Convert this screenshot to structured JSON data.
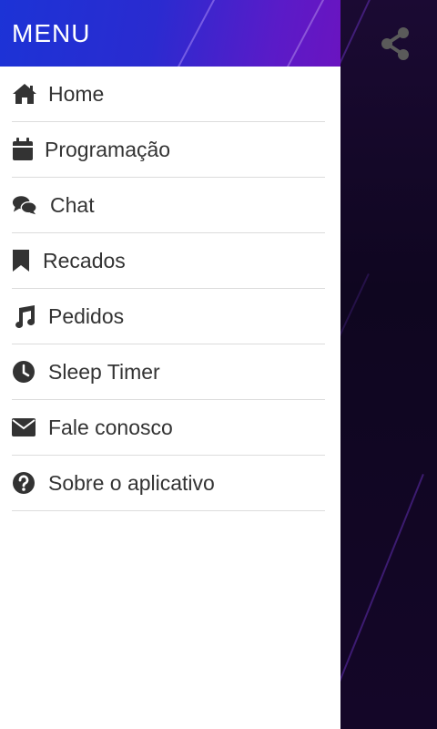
{
  "drawer": {
    "title": "MENU",
    "items": [
      {
        "label": "Home",
        "icon": "home-icon"
      },
      {
        "label": "Programação",
        "icon": "calendar-icon"
      },
      {
        "label": "Chat",
        "icon": "chat-icon"
      },
      {
        "label": "Recados",
        "icon": "bookmark-icon"
      },
      {
        "label": "Pedidos",
        "icon": "music-icon"
      },
      {
        "label": "Sleep Timer",
        "icon": "clock-icon"
      },
      {
        "label": "Fale conosco",
        "icon": "envelope-icon"
      },
      {
        "label": "Sobre o aplicativo",
        "icon": "question-icon"
      }
    ]
  },
  "share": {
    "icon": "share-icon"
  },
  "colors": {
    "header_start": "#1c33d6",
    "header_end": "#6a14c0",
    "background": "#140628",
    "text": "#333333",
    "icon": "#333333",
    "divider": "#dcdcdc"
  }
}
